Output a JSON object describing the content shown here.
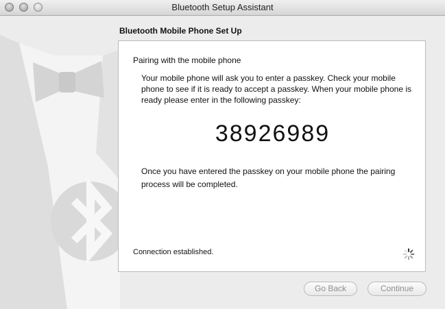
{
  "window": {
    "title": "Bluetooth Setup Assistant"
  },
  "section_title": "Bluetooth Mobile Phone Set Up",
  "panel": {
    "heading": "Pairing with the mobile phone",
    "description": "Your mobile phone will ask you to enter a passkey. Check your mobile phone to see if it is ready to accept a passkey. When your mobile phone is ready please enter in the following passkey:",
    "passkey": "38926989",
    "completion_text": "Once you have entered the passkey on your mobile phone the pairing process will be completed.",
    "status": "Connection established."
  },
  "buttons": {
    "back_label": "Go Back",
    "continue_label": "Continue"
  },
  "icons": {
    "window_controls": [
      "close-icon",
      "minimize-icon",
      "zoom-icon"
    ],
    "illustration": "bluetooth-logo-icon",
    "progress": "spinner-icon"
  }
}
